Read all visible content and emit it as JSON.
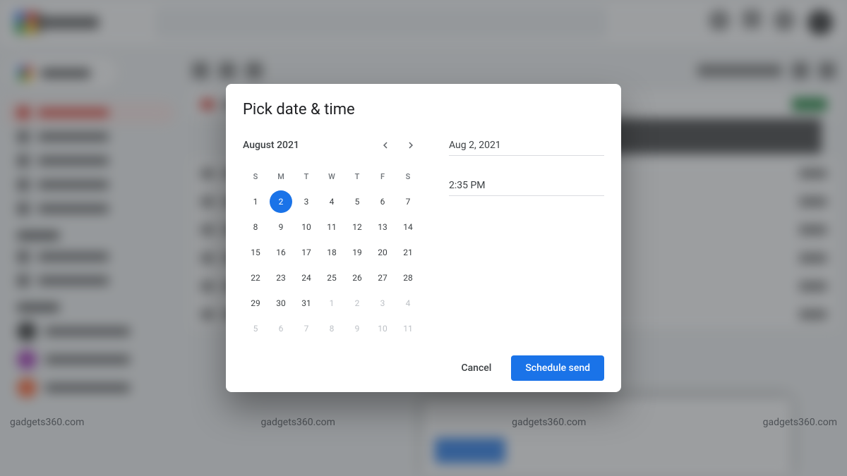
{
  "dialog": {
    "title": "Pick date & time",
    "calendar": {
      "month_label": "August 2021",
      "dow": [
        "S",
        "M",
        "T",
        "W",
        "T",
        "F",
        "S"
      ],
      "weeks": [
        [
          {
            "d": "1"
          },
          {
            "d": "2",
            "sel": true
          },
          {
            "d": "3"
          },
          {
            "d": "4"
          },
          {
            "d": "5"
          },
          {
            "d": "6"
          },
          {
            "d": "7"
          }
        ],
        [
          {
            "d": "8"
          },
          {
            "d": "9"
          },
          {
            "d": "10"
          },
          {
            "d": "11"
          },
          {
            "d": "12"
          },
          {
            "d": "13"
          },
          {
            "d": "14"
          }
        ],
        [
          {
            "d": "15"
          },
          {
            "d": "16"
          },
          {
            "d": "17"
          },
          {
            "d": "18"
          },
          {
            "d": "19"
          },
          {
            "d": "20"
          },
          {
            "d": "21"
          }
        ],
        [
          {
            "d": "22"
          },
          {
            "d": "23"
          },
          {
            "d": "24"
          },
          {
            "d": "25"
          },
          {
            "d": "26"
          },
          {
            "d": "27"
          },
          {
            "d": "28"
          }
        ],
        [
          {
            "d": "29"
          },
          {
            "d": "30"
          },
          {
            "d": "31"
          },
          {
            "d": "1",
            "o": true
          },
          {
            "d": "2",
            "o": true
          },
          {
            "d": "3",
            "o": true
          },
          {
            "d": "4",
            "o": true
          }
        ],
        [
          {
            "d": "5",
            "o": true
          },
          {
            "d": "6",
            "o": true
          },
          {
            "d": "7",
            "o": true
          },
          {
            "d": "8",
            "o": true
          },
          {
            "d": "9",
            "o": true
          },
          {
            "d": "10",
            "o": true
          },
          {
            "d": "11",
            "o": true
          }
        ]
      ]
    },
    "date_value": "Aug 2, 2021",
    "time_value": "2:35 PM",
    "cancel_label": "Cancel",
    "confirm_label": "Schedule send"
  },
  "watermark": "gadgets360.com"
}
